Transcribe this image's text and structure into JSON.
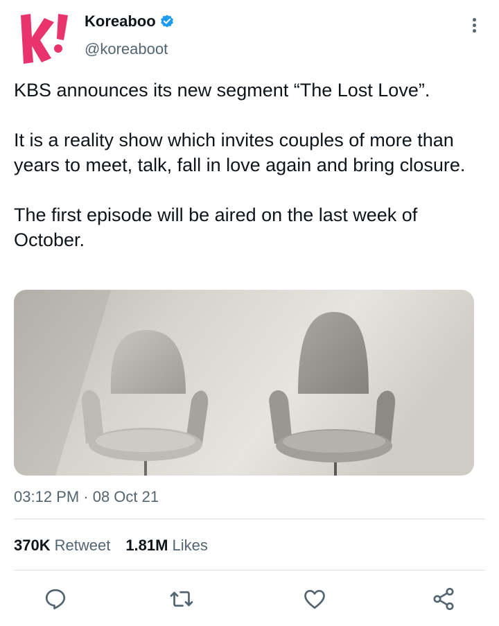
{
  "user": {
    "display_name": "Koreaboo",
    "handle": "@koreaboot",
    "verified": true,
    "avatar_icon": "koreaboo-k-logo",
    "brand_color": "#e8336c"
  },
  "tweet": {
    "text": "KBS announces its new segment “The Lost Love”.\n\nIt is a reality show which invites couples of more than years to meet, talk, fall in love again and bring closure.\n\nThe first episode will be aired on the last week of October.",
    "media_description_icon": "two-chairs-photo",
    "timestamp": "03:12 PM · 08 Oct 21"
  },
  "stats": {
    "retweets_count": "370K",
    "retweets_label": "Retweet",
    "likes_count": "1.81M",
    "likes_label": "Likes"
  },
  "actions": [
    {
      "icon": "reply-icon"
    },
    {
      "icon": "retweet-icon"
    },
    {
      "icon": "like-icon"
    },
    {
      "icon": "share-icon"
    }
  ],
  "colors": {
    "text": "#0f1419",
    "secondary": "#536471",
    "verified": "#1d9bf0",
    "divider": "#dadfe3"
  }
}
